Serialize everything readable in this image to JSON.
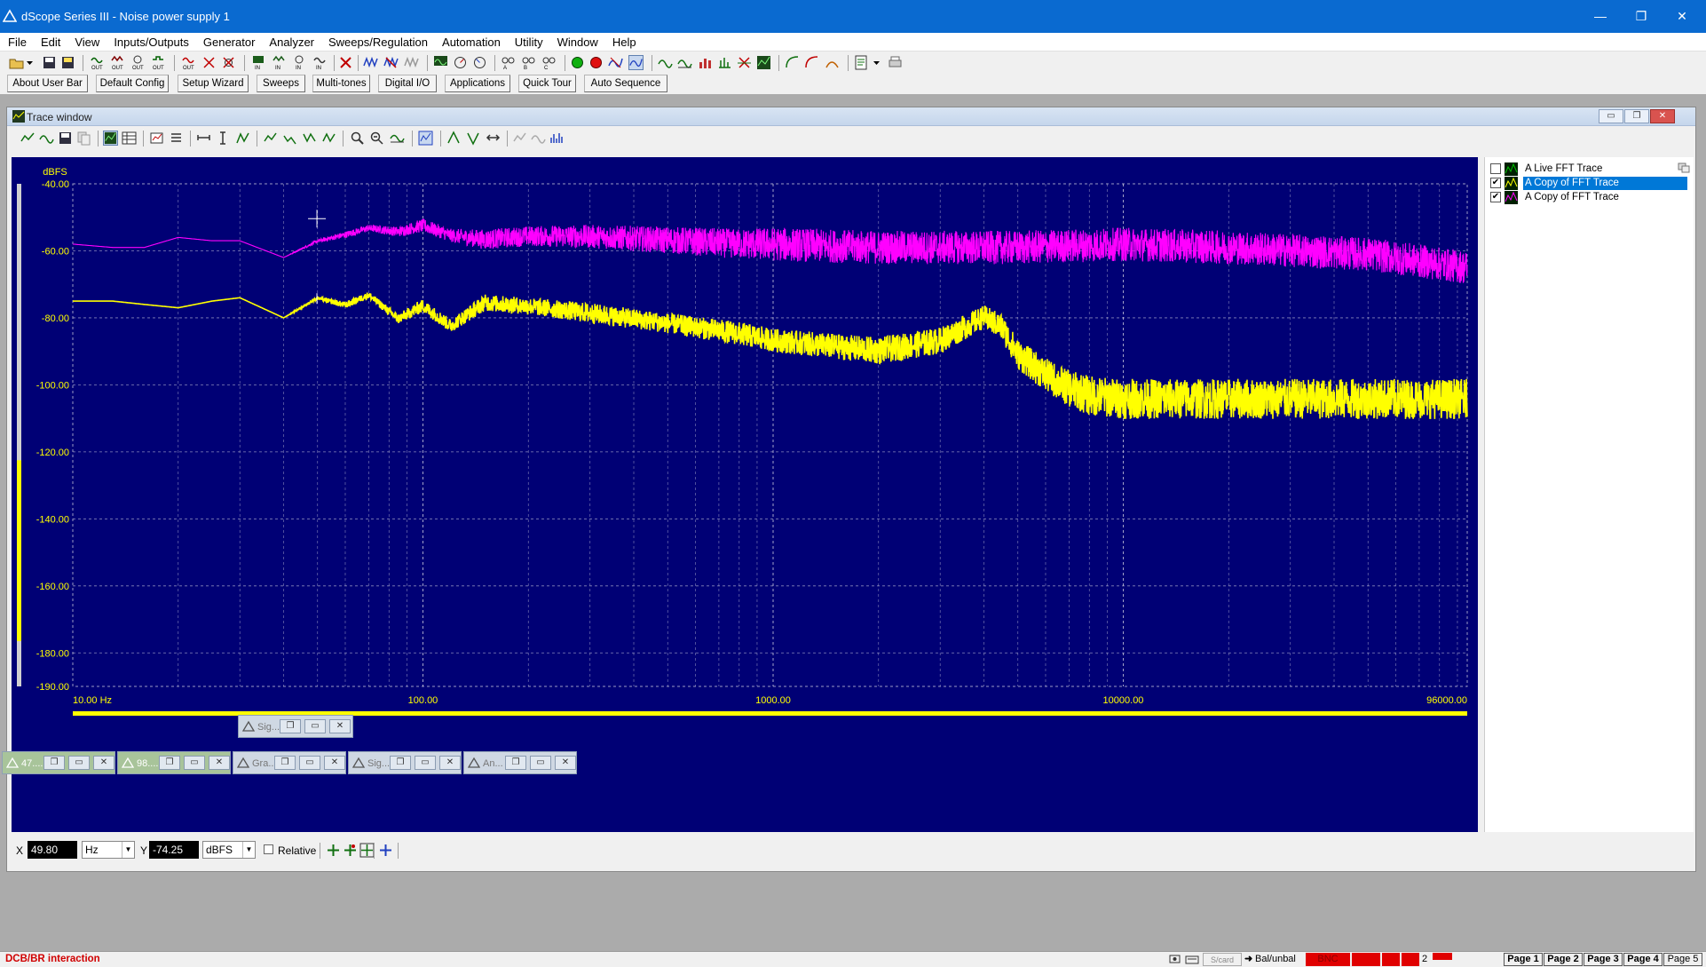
{
  "window": {
    "title": "dScope Series III - Noise power supply 1",
    "minimize": "—",
    "restore": "❐",
    "close": "✕"
  },
  "menu": [
    "File",
    "Edit",
    "View",
    "Inputs/Outputs",
    "Generator",
    "Analyzer",
    "Sweeps/Regulation",
    "Automation",
    "Utility",
    "Window",
    "Help"
  ],
  "user_bar": [
    "About User Bar",
    "Default Config",
    "Setup Wizard",
    "Sweeps",
    "Multi-tones",
    "Digital I/O",
    "Applications",
    "Quick Tour",
    "Auto Sequence"
  ],
  "trace_window": {
    "title": "Trace window",
    "controls": [
      "▭",
      "❐",
      "✕"
    ]
  },
  "traces": [
    {
      "checked": false,
      "label": "A  Live FFT Trace",
      "selected": false
    },
    {
      "checked": true,
      "label": "A  Copy of FFT Trace",
      "selected": true
    },
    {
      "checked": true,
      "label": "A  Copy of FFT Trace",
      "selected": false
    }
  ],
  "chart_data": {
    "type": "line",
    "title": "",
    "ylabel": "dBFS",
    "xlabel": "",
    "xscale": "log",
    "xlim": [
      10,
      96000
    ],
    "ylim": [
      -190,
      -40
    ],
    "x_ticks": [
      "10.00 Hz",
      "100.00",
      "1000.00",
      "10000.00",
      "96000.00"
    ],
    "y_ticks": [
      "-40.00",
      "-60.00",
      "-80.00",
      "-100.00",
      "-120.00",
      "-140.00",
      "-160.00",
      "-180.00",
      "-190.00"
    ],
    "grid": true,
    "background": "#000075",
    "series": [
      {
        "color": "#ff00ff",
        "x": [
          10,
          13,
          16,
          20,
          25,
          30,
          40,
          50,
          60,
          70,
          85,
          100,
          120,
          150,
          200,
          300,
          500,
          800,
          1000,
          2000,
          5000,
          10000,
          20000,
          50000,
          96000
        ],
        "y": [
          -58,
          -59,
          -59,
          -56,
          -57,
          -57,
          -62,
          -57,
          -55,
          -53,
          -54,
          -52,
          -55,
          -56,
          -55,
          -55,
          -56,
          -57,
          -57,
          -58,
          -58,
          -57,
          -58,
          -60,
          -64
        ],
        "noise_dB": [
          0,
          0,
          0,
          0,
          0,
          0,
          0,
          0.5,
          1,
          1,
          1.5,
          2,
          2,
          3,
          3,
          3.5,
          4,
          4.5,
          5,
          5,
          5,
          5,
          5,
          5,
          5
        ]
      },
      {
        "color": "#ffff00",
        "x": [
          10,
          13,
          16,
          20,
          25,
          30,
          40,
          50,
          60,
          70,
          85,
          100,
          120,
          150,
          200,
          300,
          500,
          800,
          1000,
          2000,
          3000,
          4000,
          4500,
          5000,
          6000,
          7000,
          8000,
          10000,
          20000,
          50000,
          96000
        ],
        "y": [
          -75,
          -75,
          -76,
          -77,
          -75,
          -74,
          -80,
          -74,
          -76,
          -73,
          -80,
          -76,
          -82,
          -75,
          -76,
          -78,
          -81,
          -84,
          -86,
          -89,
          -86,
          -79,
          -82,
          -90,
          -96,
          -100,
          -102,
          -103,
          -103,
          -103,
          -103
        ],
        "noise_dB": [
          0,
          0,
          0,
          0,
          0,
          0,
          0,
          0.5,
          1,
          1,
          1.5,
          2,
          2,
          2.5,
          2.5,
          3,
          3,
          3.5,
          3.5,
          4,
          4,
          3.5,
          4,
          4.5,
          5,
          5.5,
          6,
          6,
          6,
          6,
          6
        ]
      }
    ]
  },
  "readout": {
    "x_label": "X",
    "x_value": "49.80",
    "x_unit": "Hz",
    "y_label": "Y",
    "y_value": "-74.25",
    "y_unit": "dBFS",
    "relative_label": "Relative"
  },
  "minimized_windows": [
    {
      "title": "Sig..."
    },
    {
      "title": "47...."
    },
    {
      "title": "98...."
    },
    {
      "title": "Gra..."
    },
    {
      "title": "Sig..."
    },
    {
      "title": "An..."
    }
  ],
  "status": {
    "message": "DCB/BR interaction",
    "connector": "Bal/unbal",
    "bnc": "BNC",
    "number": "2",
    "pages": [
      "Page 1",
      "Page 2",
      "Page 3",
      "Page 4",
      "Page 5"
    ]
  }
}
